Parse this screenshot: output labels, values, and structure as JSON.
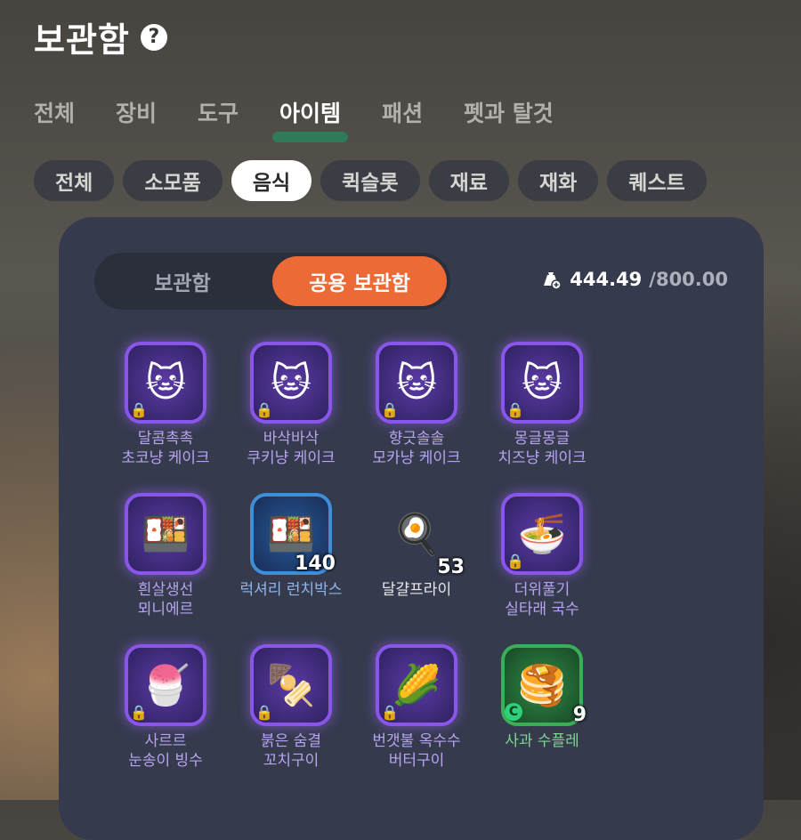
{
  "header": {
    "title": "보관함",
    "help_icon": "?"
  },
  "main_tabs": [
    "전체",
    "장비",
    "도구",
    "아이템",
    "패션",
    "펫과 탈것"
  ],
  "sub_tabs": [
    "전체",
    "소모품",
    "음식",
    "퀵슬롯",
    "재료",
    "재화",
    "퀘스트"
  ],
  "storage_toggle": {
    "personal": "보관함",
    "shared": "공용 보관함"
  },
  "capacity": {
    "used": "444.49",
    "max": "/800.00"
  },
  "items": [
    {
      "name": "달콤촉촉\n초코냥 케이크",
      "glyph": "🐱",
      "locked": "🔒",
      "count": "",
      "tier": "purple"
    },
    {
      "name": "바삭바삭\n쿠키냥 케이크",
      "glyph": "🐱",
      "locked": "🔒",
      "count": "",
      "tier": "purple"
    },
    {
      "name": "향긋솔솔\n모카냥 케이크",
      "glyph": "🐱",
      "locked": "🔒",
      "count": "",
      "tier": "purple"
    },
    {
      "name": "몽글몽글\n치즈냥 케이크",
      "glyph": "🐱",
      "locked": "🔒",
      "count": "",
      "tier": "purple"
    },
    {
      "name": "흰살생선\n뫼니에르",
      "glyph": "🍱",
      "locked": "",
      "count": "",
      "tier": "purple"
    },
    {
      "name": "럭셔리 런치박스",
      "glyph": "🍱",
      "locked": "",
      "count": "140",
      "tier": "blue"
    },
    {
      "name": "달걀프라이",
      "glyph": "🍳",
      "locked": "",
      "count": "53",
      "tier": "none"
    },
    {
      "name": "더위풀기\n실타래 국수",
      "glyph": "🍜",
      "locked": "🔒",
      "count": "",
      "tier": "purple"
    },
    {
      "name": "사르르\n눈송이 빙수",
      "glyph": "🍧",
      "locked": "🔒",
      "count": "",
      "tier": "purple"
    },
    {
      "name": "붉은 숨결\n꼬치구이",
      "glyph": "🍢",
      "locked": "🔒",
      "count": "",
      "tier": "purple"
    },
    {
      "name": "번갯불 옥수수\n버터구이",
      "glyph": "🌽",
      "locked": "🔒",
      "count": "",
      "tier": "purple"
    },
    {
      "name": "사과 수플레",
      "glyph": "🥞",
      "locked": "",
      "count": "9",
      "tier": "green",
      "trade": "C"
    }
  ]
}
